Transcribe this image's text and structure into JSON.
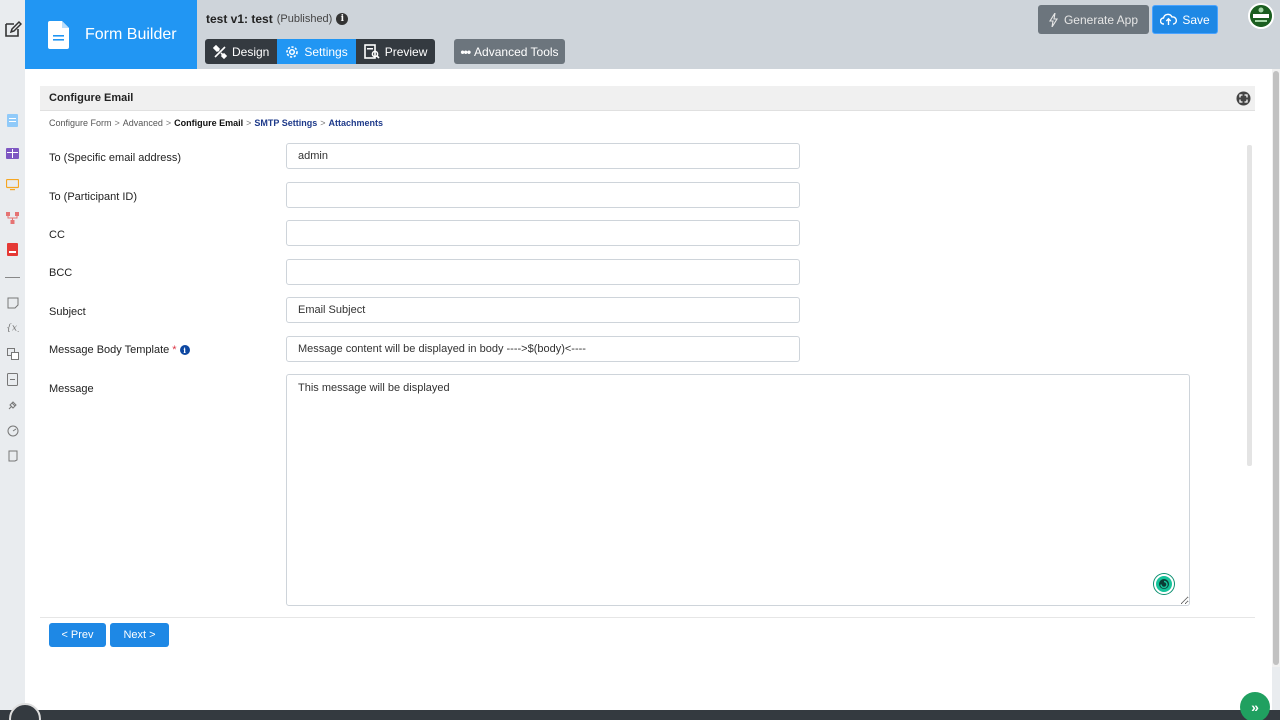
{
  "brand": {
    "title": "Form Builder"
  },
  "app": {
    "name": "test v1: test",
    "status": "(Published)"
  },
  "tabs": [
    {
      "label": "Design",
      "icon": "tools-icon"
    },
    {
      "label": "Settings",
      "icon": "gear-icon",
      "active": true
    },
    {
      "label": "Preview",
      "icon": "preview-icon"
    }
  ],
  "advanced_tools": {
    "label": "Advanced Tools",
    "icon": "ellipsis-icon"
  },
  "toolbar": {
    "generate_label": "Generate App",
    "save_label": "Save"
  },
  "panel": {
    "title": "Configure Email"
  },
  "breadcrumb": {
    "items": [
      "Configure Form",
      "Advanced",
      "Configure Email",
      "SMTP Settings",
      "Attachments"
    ],
    "separator": ">"
  },
  "form": {
    "to_email": {
      "label": "To (Specific email address)",
      "value": "admin"
    },
    "to_participant": {
      "label": "To (Participant ID)",
      "value": ""
    },
    "cc": {
      "label": "CC",
      "value": ""
    },
    "bcc": {
      "label": "BCC",
      "value": ""
    },
    "subject": {
      "label": "Subject",
      "value": "Email Subject"
    },
    "body_template": {
      "label": "Message Body Template",
      "required_mark": "*",
      "value": "Message content will be displayed in body ---->$(body)<----"
    },
    "message": {
      "label": "Message",
      "value": "This message will be displayed"
    }
  },
  "nav": {
    "prev_label": "< Prev",
    "next_label": "Next >"
  },
  "colors": {
    "primary": "#2196f3",
    "dark": "#343a40",
    "secondary": "#6c757d",
    "header_bg": "#ced4da",
    "required": "#dc3545"
  }
}
